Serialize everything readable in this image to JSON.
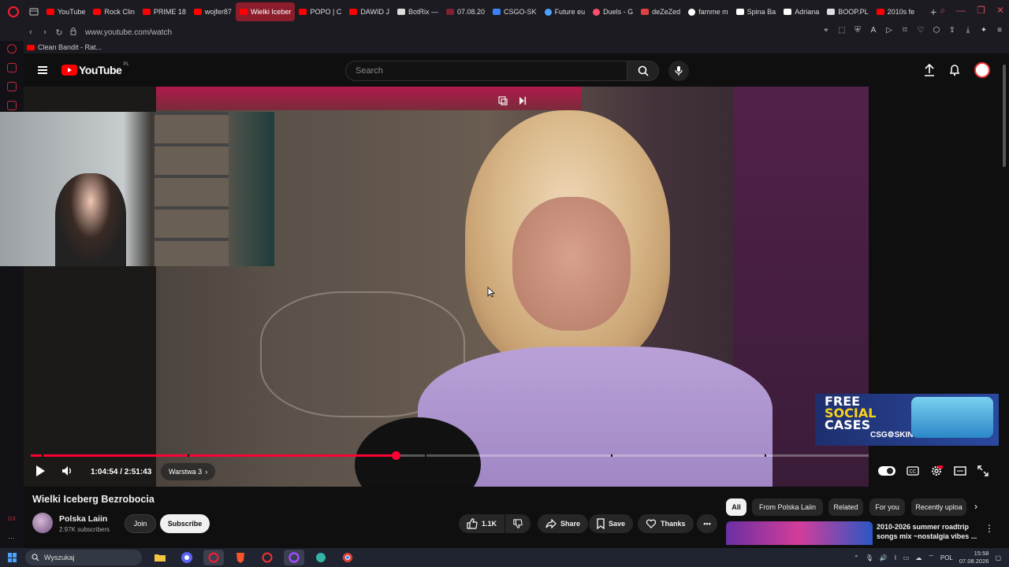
{
  "browser": {
    "tabs": [
      {
        "label": "YouTube",
        "fav": "yt"
      },
      {
        "label": "Rock Clin",
        "fav": "yt"
      },
      {
        "label": "PRIME 18",
        "fav": "yt"
      },
      {
        "label": "wojfer87",
        "fav": "yt"
      },
      {
        "label": "Wielki Iceber",
        "fav": "speaker",
        "active": true
      },
      {
        "label": "POPO | C",
        "fav": "yt"
      },
      {
        "label": "DAWID J",
        "fav": "yt"
      },
      {
        "label": "BotRix —",
        "fav": "diamond"
      },
      {
        "label": "07.08.20",
        "fav": "dark"
      },
      {
        "label": "CSGO-SK",
        "fav": "blue"
      },
      {
        "label": "Future eu",
        "fav": "globe"
      },
      {
        "label": "Duels - G",
        "fav": "pin"
      },
      {
        "label": "deZeZed",
        "fav": "dz"
      },
      {
        "label": "famme m",
        "fav": "google"
      },
      {
        "label": "Spina Ba",
        "fav": "tiktok"
      },
      {
        "label": "Adriana",
        "fav": "tiktok"
      },
      {
        "label": "BOOP.PL",
        "fav": "x"
      },
      {
        "label": "2010s fe",
        "fav": "yt"
      }
    ],
    "url": "www.youtube.com/watch",
    "bookmark": "Clean Bandit - Rat..."
  },
  "youtube": {
    "logo": "YouTube",
    "country": "PL",
    "search_placeholder": "Search"
  },
  "player": {
    "time": "1:04:54 / 2:51:43",
    "chapter": "Warstwa 3",
    "progress": 0.4357,
    "chapter_marks": [
      0.013,
      0.187,
      0.47,
      0.692,
      0.876
    ]
  },
  "ad": {
    "line1": "FREE",
    "line2": "SOCIAL",
    "line3": "CASES",
    "brand": "CSG⚙SKINS"
  },
  "video": {
    "title": "Wielki Iceberg Bezrobocia",
    "channel": "Polska Laiin",
    "subscribers": "2.97K subscribers",
    "join": "Join",
    "subscribe": "Subscribe",
    "likes": "1.1K",
    "share": "Share",
    "save": "Save",
    "thanks": "Thanks"
  },
  "chips": [
    "All",
    "From Polska Laiin",
    "Related",
    "For you",
    "Recently uploa"
  ],
  "recommendation": {
    "title": "2010-2026 summer roadtrip songs mix ~nostalgia vibes ..."
  },
  "taskbar": {
    "search": "Wyszukaj",
    "lang": "POL",
    "time": "15:58",
    "date": "07.08.2026"
  },
  "colors": {
    "yt_red": "#ff0000",
    "progress": "#ff0033",
    "opera_red": "#ff1b2d"
  }
}
